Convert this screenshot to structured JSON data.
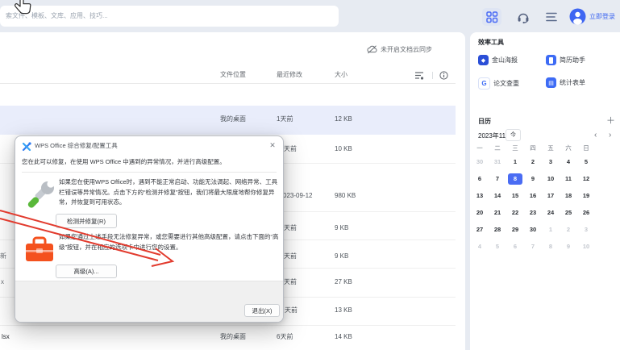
{
  "topbar": {
    "search_placeholder": "索文件、模板、文库、应用、技巧...",
    "login_label": "立即登录"
  },
  "filelist": {
    "sync_notice": "未开启文档云同步",
    "columns": {
      "location": "文件位置",
      "modified": "最近修改",
      "size": "大小"
    },
    "rows": [
      {
        "name": "",
        "location": "我的桌面",
        "modified": "1天前",
        "size": "12 KB"
      },
      {
        "name": "",
        "location": "",
        "modified": "天前",
        "size": "10 KB"
      },
      {
        "name": "",
        "location": "",
        "modified": "023-09-12",
        "size": "980 KB"
      },
      {
        "name": "",
        "location": "",
        "modified": "天前",
        "size": "9 KB"
      },
      {
        "name": "新",
        "location": "",
        "modified": "天前",
        "size": "9 KB"
      },
      {
        "name": "x",
        "location": "",
        "modified": "天前",
        "size": "27 KB"
      },
      {
        "name": "",
        "location": "",
        "modified": "天前",
        "size": "13 KB"
      },
      {
        "name": "lsx",
        "location": "我的桌面",
        "modified": "6天前",
        "size": "14 KB"
      }
    ]
  },
  "dialog": {
    "title": "WPS Office 综合修复/配置工具",
    "intro": "您在此可以修复，在使用 WPS Office 中遇到的异常情况，并进行高级配置。",
    "repair_text": "如果您在使用WPS Office时，遇到不能正常启动、功能无法调起、网络异常、工具栏错误等异常情况。点击下方的“检测并修复”按钮，我们将最大限度地帮你修复异常，并恢复到可用状态。",
    "repair_button": "检测并修复(R)",
    "advanced_text": "如果您通过上述手段无法修复异常，或您需要进行其他高级配置，请点击下面的“高级”按钮，并在相应的选项卡中进行您的设置。",
    "advanced_button": "高级(A)...",
    "exit_button": "退出(X)"
  },
  "sidebar": {
    "tools_title": "效率工具",
    "tools": [
      {
        "label": "金山海报"
      },
      {
        "label": "简历助手"
      },
      {
        "label": "论文查重"
      },
      {
        "label": "统计表单"
      }
    ],
    "calendar": {
      "title": "日历",
      "month": "2023年11月",
      "today_button": "今",
      "selected_day": "8",
      "weekdays": [
        "一",
        "二",
        "三",
        "四",
        "五",
        "六",
        "日"
      ],
      "weeks": [
        [
          "30",
          "31",
          "1",
          "2",
          "3",
          "4",
          "5"
        ],
        [
          "6",
          "7",
          "8",
          "9",
          "10",
          "11",
          "12"
        ],
        [
          "13",
          "14",
          "15",
          "16",
          "17",
          "18",
          "19"
        ],
        [
          "20",
          "21",
          "22",
          "23",
          "24",
          "25",
          "26"
        ],
        [
          "27",
          "28",
          "29",
          "30",
          "1",
          "2",
          "3"
        ],
        [
          "4",
          "5",
          "6",
          "7",
          "8",
          "9",
          "10"
        ]
      ]
    }
  },
  "icons": {
    "close": "✕",
    "plus": "＋",
    "chev_left": "‹",
    "chev_right": "›",
    "diamond": "◆",
    "g_letter": "G",
    "layers": "▤"
  },
  "colors": {
    "accent_blue": "#3c66f0",
    "selected_day_bg": "#4a6cf3",
    "highlight_row": "#e9edfb",
    "toolbox_orange": "#f4511e",
    "arrow_red": "#e23b2e"
  }
}
